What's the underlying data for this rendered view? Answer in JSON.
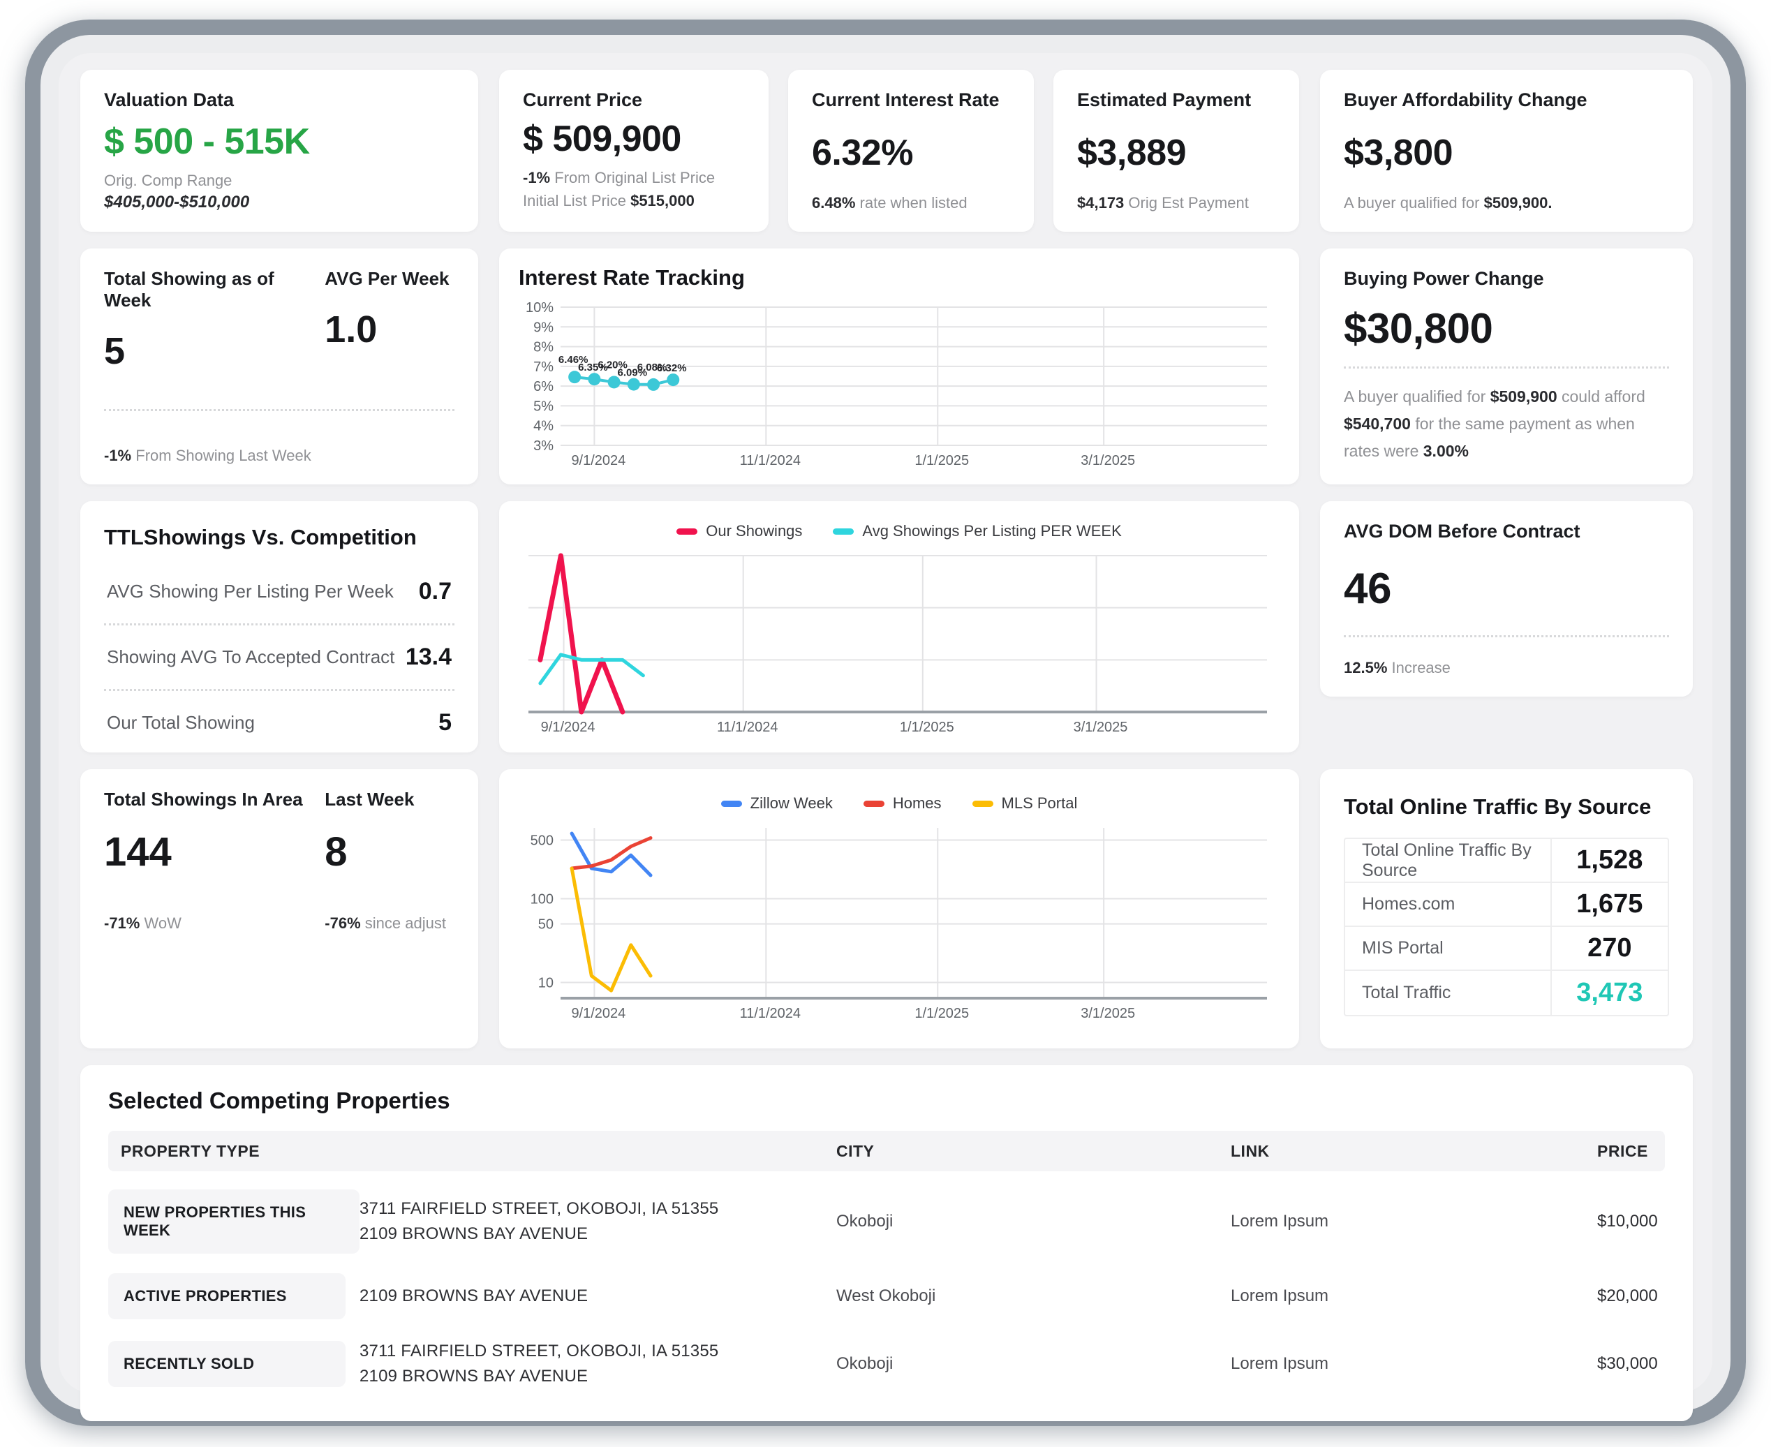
{
  "colors": {
    "valuation_green": "#27a546",
    "traffic_total_teal": "#1fc7b5"
  },
  "cards": {
    "valuation": {
      "title": "Valuation Data",
      "value": "$ 500 - 515K",
      "sub_label": "Orig. Comp Range",
      "sub_value": "$405,000-$510,000"
    },
    "current_price": {
      "title": "Current Price",
      "value": "$ 509,900",
      "delta": "-1%",
      "delta_rest": "From Original List Price",
      "initial_label": "Initial List Price",
      "initial_value": "$515,000"
    },
    "current_interest_rate": {
      "title": "Current Interest Rate",
      "value": "6.32%",
      "note_strong": "6.48%",
      "note_rest": "rate when listed"
    },
    "estimated_payment": {
      "title": "Estimated Payment",
      "value": "$3,889",
      "note_strong": "$4,173",
      "note_rest": "Orig Est Payment"
    },
    "buyer_affordability": {
      "title": "Buyer Affordability Change",
      "value": "$3,800",
      "note_rest": "A buyer qualified for",
      "note_strong": "$509,900."
    },
    "total_showing": {
      "title_left": "Total Showing as of Week",
      "value_left": "5",
      "title_right": "AVG Per Week",
      "value_right": "1.0",
      "note_strong": "-1%",
      "note_rest": "From Showing Last Week"
    },
    "buying_power": {
      "title": "Buying Power Change",
      "value": "$30,800",
      "note_1": "A buyer qualified for ",
      "note_2": "$509,900",
      "note_3": " could afford ",
      "note_4": "$540,700",
      "note_5": " for the same payment as when rates were ",
      "note_6": "3.00%"
    },
    "ttl_showings": {
      "title": "TTLShowings Vs. Competition",
      "rows": [
        {
          "label": "AVG Showing Per Listing Per Week",
          "value": "0.7"
        },
        {
          "label": "Showing AVG To Accepted Contract",
          "value": "13.4"
        },
        {
          "label": "Our Total Showing",
          "value": "5"
        }
      ]
    },
    "avg_dom": {
      "title": "AVG DOM Before Contract",
      "value": "46",
      "note_strong": "12.5%",
      "note_rest": "Increase"
    },
    "showings_area": {
      "title_left": "Total Showings In Area",
      "value_left": "144",
      "note_left_strong": "-71%",
      "note_left_rest": "WoW",
      "title_right": "Last Week",
      "value_right": "8",
      "note_right_strong": "-76%",
      "note_right_rest": "since adjust"
    },
    "traffic_table": {
      "title": "Total Online Traffic By Source",
      "rows": [
        {
          "label": "Total Online Traffic By Source",
          "value": "1,528"
        },
        {
          "label": "Homes.com",
          "value": "1,675"
        },
        {
          "label": "MIS Portal",
          "value": "270"
        },
        {
          "label": "Total Traffic",
          "value": "3,473"
        }
      ]
    }
  },
  "chart_data": {
    "interest_rate": {
      "type": "line",
      "title": "Interest Rate Tracking",
      "x_axis": {
        "min": "2024-08-20",
        "max": "2025-04-28",
        "ticks": [
          {
            "date": "2024-09-01",
            "label": "9/1/2024"
          },
          {
            "date": "2024-11-01",
            "label": "11/1/2024"
          },
          {
            "date": "2025-01-01",
            "label": "1/1/2025"
          },
          {
            "date": "2025-03-01",
            "label": "3/1/2025"
          }
        ]
      },
      "y_axis": {
        "min": 3,
        "max": 10,
        "scale": "linear",
        "show_labels": true,
        "gridlines": [
          3,
          4,
          5,
          6,
          7,
          8,
          9,
          10
        ],
        "tick_labels": [
          "3%",
          "4%",
          "5%",
          "6%",
          "7%",
          "8%",
          "9%",
          "10%"
        ]
      },
      "baseline": false,
      "series": [
        {
          "name": "Interest Rate",
          "color": "#3cc8d7",
          "width": 4,
          "markers": true,
          "marker_r": 9,
          "x": [
            "2024-08-25",
            "2024-09-01",
            "2024-09-08",
            "2024-09-15",
            "2024-09-22",
            "2024-09-29"
          ],
          "y": [
            6.46,
            6.35,
            6.2,
            6.09,
            6.08,
            6.32
          ],
          "labels": [
            "6.46%",
            "6.35%",
            "6.20%",
            "6.09%",
            "6.08%",
            "6.32%"
          ]
        }
      ]
    },
    "showings": {
      "type": "line",
      "legend": [
        {
          "label": "Our Showings",
          "color": "#f0134d"
        },
        {
          "label": "Avg Showings Per Listing PER WEEK",
          "color": "#2fd5de"
        }
      ],
      "x_axis": {
        "min": "2024-08-20",
        "max": "2025-04-28",
        "ticks": [
          {
            "date": "2024-09-01",
            "label": "9/1/2024"
          },
          {
            "date": "2024-11-01",
            "label": "11/1/2024"
          },
          {
            "date": "2025-01-01",
            "label": "1/1/2025"
          },
          {
            "date": "2025-03-01",
            "label": "3/1/2025"
          }
        ]
      },
      "y_axis": {
        "min": 0,
        "max": 3,
        "scale": "linear",
        "show_labels": false,
        "gridlines": [
          1,
          2,
          3
        ],
        "tick_labels": []
      },
      "baseline": true,
      "series": [
        {
          "name": "Our Showings",
          "color": "#f0134d",
          "width": 7,
          "x": [
            "2024-08-24",
            "2024-08-31",
            "2024-09-07",
            "2024-09-14",
            "2024-09-21"
          ],
          "y": [
            1,
            3,
            0,
            1,
            0
          ]
        },
        {
          "name": "Avg Showings Per Listing PER WEEK",
          "color": "#2fd5de",
          "width": 5,
          "x": [
            "2024-08-24",
            "2024-08-31",
            "2024-09-07",
            "2024-09-14",
            "2024-09-21",
            "2024-09-28"
          ],
          "y": [
            0.55,
            1.1,
            1.0,
            1.0,
            1.0,
            0.7
          ]
        }
      ]
    },
    "traffic": {
      "type": "line",
      "legend": [
        {
          "label": "Zillow Week",
          "color": "#4285f4"
        },
        {
          "label": "Homes",
          "color": "#ea4335"
        },
        {
          "label": "MLS Portal",
          "color": "#fbbc04"
        }
      ],
      "x_axis": {
        "min": "2024-08-20",
        "max": "2025-04-28",
        "ticks": [
          {
            "date": "2024-09-01",
            "label": "9/1/2024"
          },
          {
            "date": "2024-11-01",
            "label": "11/1/2024"
          },
          {
            "date": "2025-01-01",
            "label": "1/1/2025"
          },
          {
            "date": "2025-03-01",
            "label": "3/1/2025"
          }
        ]
      },
      "y_axis": {
        "min": 6.5,
        "max": 700,
        "scale": "log",
        "show_labels": true,
        "gridlines": [
          10,
          50,
          100,
          500
        ],
        "tick_labels": [
          "10",
          "50",
          "100",
          "500"
        ]
      },
      "baseline": true,
      "series": [
        {
          "name": "Zillow Week",
          "color": "#4285f4",
          "width": 5,
          "x": [
            "2024-08-24",
            "2024-08-31",
            "2024-09-07",
            "2024-09-14",
            "2024-09-21"
          ],
          "y": [
            600,
            230,
            210,
            330,
            190
          ]
        },
        {
          "name": "Homes",
          "color": "#ea4335",
          "width": 5,
          "x": [
            "2024-08-24",
            "2024-08-31",
            "2024-09-07",
            "2024-09-14",
            "2024-09-21"
          ],
          "y": [
            230,
            245,
            290,
            420,
            530
          ]
        },
        {
          "name": "MLS Portal",
          "color": "#fbbc04",
          "width": 5,
          "x": [
            "2024-08-24",
            "2024-08-31",
            "2024-09-07",
            "2024-09-14",
            "2024-09-21"
          ],
          "y": [
            230,
            12,
            8,
            28,
            12
          ]
        }
      ]
    }
  },
  "competing": {
    "title": "Selected Competing Properties",
    "headers": [
      "PROPERTY TYPE",
      "CITY",
      "LINK",
      "PRICE"
    ],
    "rows": [
      {
        "type": "NEW PROPERTIES THIS WEEK",
        "address1": "3711 FAIRFIELD STREET, OKOBOJI, IA 51355",
        "address2": "2109 BROWNS BAY AVENUE",
        "city": "Okoboji",
        "link": "Lorem Ipsum",
        "price": "$10,000"
      },
      {
        "type": "ACTIVE PROPERTIES",
        "address1": "2109 BROWNS BAY AVENUE",
        "address2": "",
        "city": "West Okoboji",
        "link": "Lorem Ipsum",
        "price": "$20,000"
      },
      {
        "type": "RECENTLY SOLD",
        "address1": "3711 FAIRFIELD STREET, OKOBOJI, IA 51355",
        "address2": "2109 BROWNS BAY AVENUE",
        "city": "Okoboji",
        "link": "Lorem Ipsum",
        "price": "$30,000"
      }
    ]
  }
}
